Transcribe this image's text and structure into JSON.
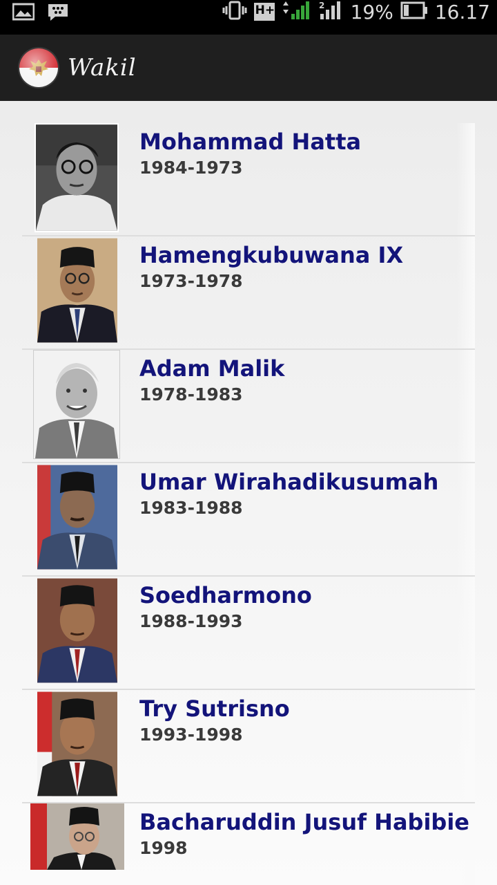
{
  "status_bar": {
    "battery_percent": "19%",
    "time": "16.17",
    "network_type": "H+",
    "icons": [
      "image-icon",
      "bbm-chat-icon",
      "vibrate-icon",
      "network-type-icon",
      "data-arrows-icon",
      "signal-icon",
      "sim2-signal-icon",
      "battery-icon"
    ]
  },
  "action_bar": {
    "title": "Wakil",
    "logo_icon": "garuda-logo-icon"
  },
  "colors": {
    "name_text": "#13147a",
    "years_text": "#3a3a3a",
    "action_bar_bg": "#1f1f1f"
  },
  "people": [
    {
      "name": "Mohammad Hatta",
      "years": "1984-1973"
    },
    {
      "name": "Hamengkubuwana IX",
      "years": "1973-1978"
    },
    {
      "name": "Adam Malik",
      "years": "1978-1983"
    },
    {
      "name": "Umar Wirahadikusumah",
      "years": "1983-1988"
    },
    {
      "name": "Soedharmono",
      "years": "1988-1993"
    },
    {
      "name": "Try Sutrisno",
      "years": "1993-1998"
    },
    {
      "name": "Bacharuddin Jusuf Habibie",
      "years": "1998"
    }
  ]
}
